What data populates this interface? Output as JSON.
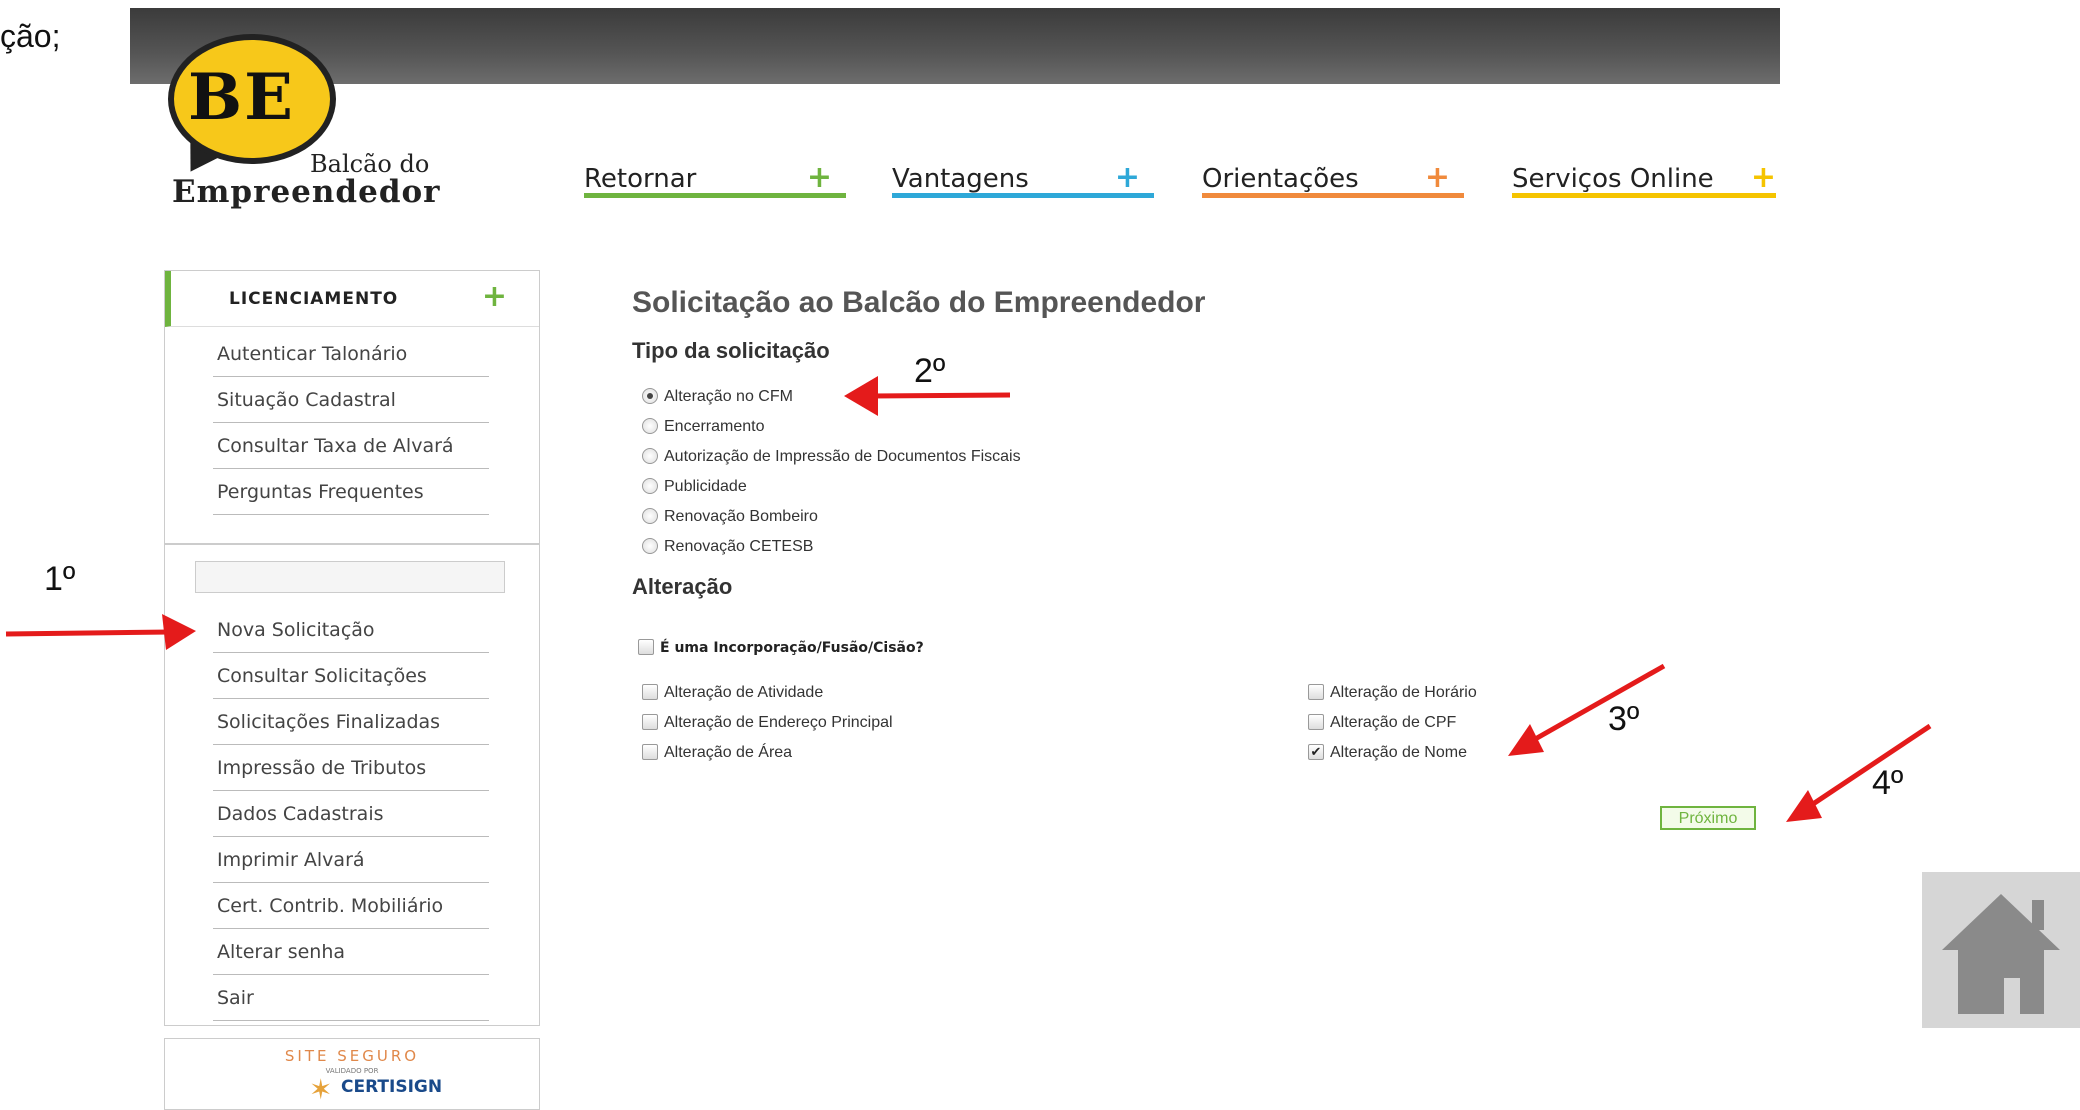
{
  "slide_text": "ção;",
  "logo": {
    "be": "BE",
    "line1": "Balcão do",
    "line2": "Empreendedor"
  },
  "nav": [
    {
      "label": "Retornar",
      "plus": "+",
      "color": "#6fb43f"
    },
    {
      "label": "Vantagens",
      "plus": "+",
      "color": "#2ea8d8"
    },
    {
      "label": "Orientações",
      "plus": "+",
      "color": "#f08a3c"
    },
    {
      "label": "Serviços Online",
      "plus": "+",
      "color": "#f5c400"
    }
  ],
  "sidebar": {
    "heading": "LICENCIAMENTO",
    "heading_plus": "+",
    "top_items": [
      "Autenticar Talonário",
      "Situação Cadastral",
      "Consultar Taxa de Alvará",
      "Perguntas Frequentes"
    ],
    "items": [
      "Nova Solicitação",
      "Consultar Solicitações",
      "Solicitações Finalizadas",
      "Impressão de Tributos",
      "Dados Cadastrais",
      "Imprimir Alvará",
      "Cert. Contrib. Mobiliário",
      "Alterar senha",
      "Sair"
    ]
  },
  "seal": {
    "line1": "SITE SEGURO",
    "line2": "VALIDADO POR",
    "brand": "CERTISIGN"
  },
  "main": {
    "title": "Solicitação ao Balcão do Empreendedor",
    "type_heading": "Tipo da solicitação",
    "types": [
      {
        "label": "Alteração no CFM",
        "checked": true
      },
      {
        "label": "Encerramento",
        "checked": false
      },
      {
        "label": "Autorização de Impressão de Documentos Fiscais",
        "checked": false
      },
      {
        "label": "Publicidade",
        "checked": false
      },
      {
        "label": "Renovação Bombeiro",
        "checked": false
      },
      {
        "label": "Renovação CETESB",
        "checked": false
      }
    ],
    "change_heading": "Alteração",
    "incorporation": {
      "label": "É uma Incorporação/Fusão/Cisão?",
      "checked": false
    },
    "changes_left": [
      {
        "label": "Alteração de Atividade",
        "checked": false
      },
      {
        "label": "Alteração de Endereço Principal",
        "checked": false
      },
      {
        "label": "Alteração de Área",
        "checked": false
      }
    ],
    "changes_right": [
      {
        "label": "Alteração de Horário",
        "checked": false
      },
      {
        "label": "Alteração de CPF",
        "checked": false
      },
      {
        "label": "Alteração de Nome",
        "checked": true
      }
    ],
    "next_label": "Próximo"
  },
  "annotations": {
    "step1": "1º",
    "step2": "2º",
    "step3": "3º",
    "step4": "4º",
    "arrow_color": "#e41b1b"
  },
  "home_icon": "home-icon"
}
